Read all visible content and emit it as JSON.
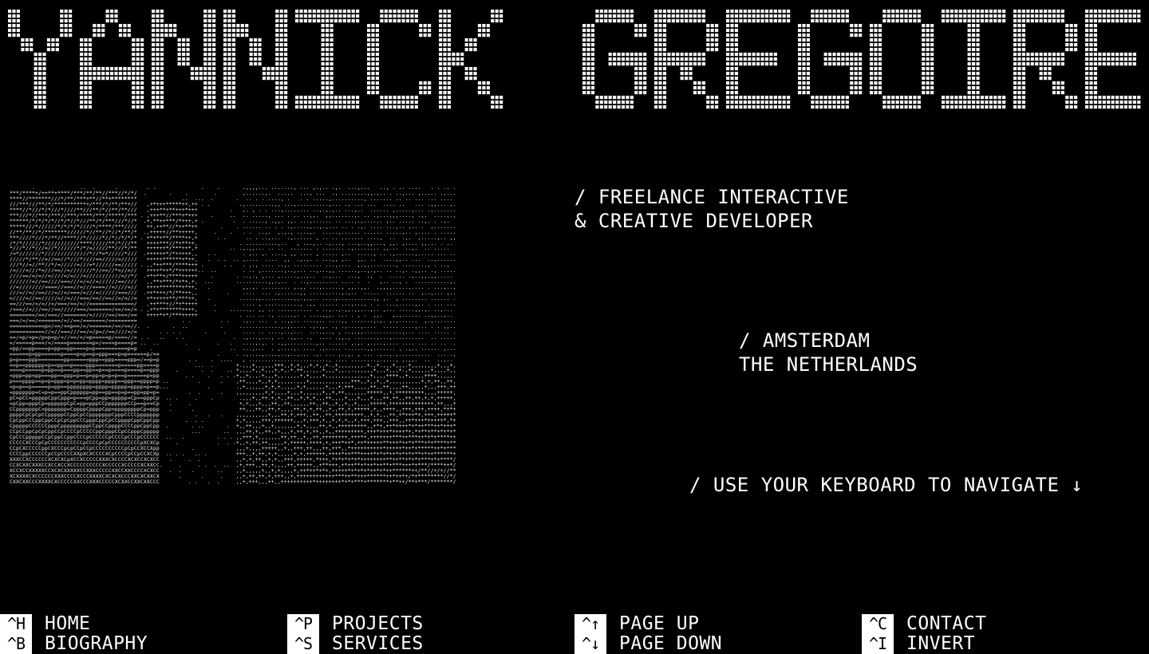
{
  "header": {
    "title": "YANNICK GREGOIRE"
  },
  "intro": {
    "role_line1": "/ FREELANCE INTERACTIVE",
    "role_line2": "& CREATIVE DEVELOPER",
    "location_line1": "/ AMSTERDAM",
    "location_line2": "THE NETHERLANDS",
    "hint": "/ USE YOUR KEYBOARD TO NAVIGATE ↓"
  },
  "portrait": {
    "icon": "ascii-portrait"
  },
  "shortcuts": [
    {
      "key": "^H",
      "label": "HOME"
    },
    {
      "key": "^B",
      "label": "BIOGRAPHY"
    },
    {
      "key": "^P",
      "label": "PROJECTS"
    },
    {
      "key": "^S",
      "label": "SERVICES"
    },
    {
      "key": "^↑",
      "label": "PAGE UP"
    },
    {
      "key": "^↓",
      "label": "PAGE DOWN"
    },
    {
      "key": "^C",
      "label": "CONTACT"
    },
    {
      "key": "^I",
      "label": "INVERT"
    }
  ],
  "colors": {
    "background": "#000000",
    "foreground": "#ffffff"
  }
}
